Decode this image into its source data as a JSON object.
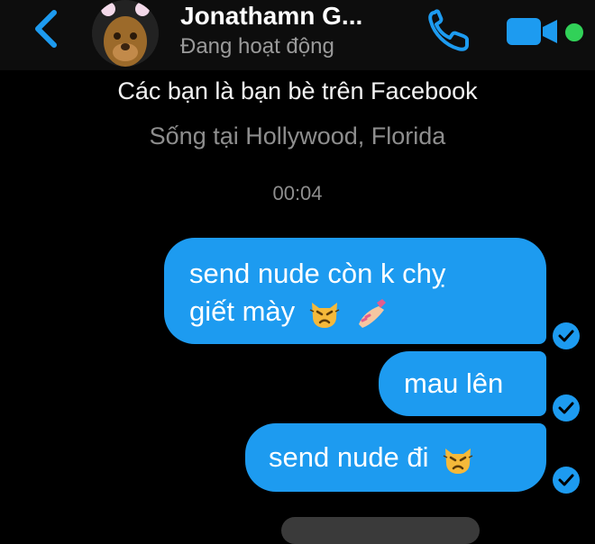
{
  "header": {
    "name": "Jonathamn G...",
    "status": "Đang hoạt động",
    "icons": {
      "back": "chevron-left-icon",
      "phone": "phone-icon",
      "video": "video-camera-icon"
    },
    "accent_color": "#1d9bf0",
    "online_color": "#31d158"
  },
  "info": {
    "friends_text": "Các bạn là bạn bè trên Facebook",
    "location_text": "Sống tại Hollywood, Florida"
  },
  "timestamp": "00:04",
  "messages": [
    {
      "line1": "send nude còn k chỵ",
      "line2": "giết mày",
      "emojis": [
        "pouting-cat-emoji",
        "nail-polish-emoji"
      ],
      "status": "sent-check-icon"
    },
    {
      "line1": "mau lên",
      "status": "sent-check-icon"
    },
    {
      "line1": "send nude đi",
      "emojis": [
        "pouting-cat-emoji"
      ],
      "status": "sent-check-icon"
    }
  ]
}
